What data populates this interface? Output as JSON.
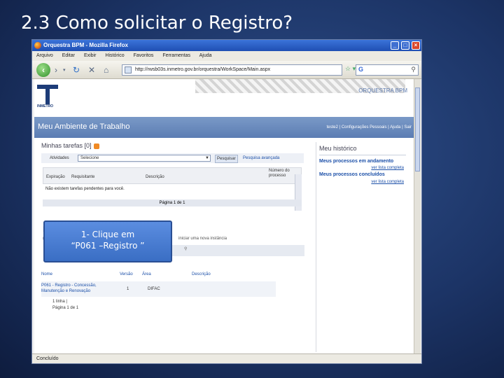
{
  "slide": {
    "title": "2.3  Como solicitar o Registro?"
  },
  "browser": {
    "window_title": "Orquestra BPM - Mozilla Firefox",
    "menu": [
      "Arquivo",
      "Editar",
      "Exibir",
      "Histórico",
      "Favoritos",
      "Ferramentas",
      "Ajuda"
    ],
    "url": "http://rwsb03s.inmetro.gov.br/orquestra/WorkSpace/Main.aspx",
    "status": "Concluído",
    "icons": {
      "back": "back-arrow-icon",
      "reload": "reload-icon",
      "stop": "stop-icon",
      "home": "home-icon",
      "search": "search-icon"
    }
  },
  "page": {
    "logo_text": "INMETRO",
    "brand": "ORQUESTRA BPM",
    "header_title": "Meu Ambiente de Trabalho",
    "header_links": "teste2 | Configurações Pessoais | Ajuda | Sair",
    "tasks": {
      "title": "Minhas tarefas [0]",
      "filter_label": "Atividades",
      "filter_value": "Selecione",
      "search_button": "Pesquisar",
      "advanced_link": "Pesquisa avançada",
      "columns": [
        "Expiração",
        "Requisitante",
        "Descrição",
        "Número do processo"
      ],
      "empty_message": "Não existem tarefas pendentes para você.",
      "paging": "Página 1 de 1"
    },
    "start": {
      "title_fragment": "P",
      "desc_fragment": "U",
      "desc_rest": "iniciar uma nova instância",
      "columns": [
        "Nome",
        "Versão",
        "Área",
        "Descrição"
      ],
      "rows": [
        {
          "name": "P061 - Registro - Concessão, Manutenção e Renovação",
          "version": "1",
          "area": "DIFAC",
          "description": ""
        }
      ],
      "count": "1 linha |",
      "paging": "Página 1 de 1"
    },
    "history": {
      "title": "Meu histórico",
      "in_progress": "Meus processos em andamento",
      "completed": "Meus processos concluídos",
      "see_all": "ver lista completa"
    }
  },
  "callout": {
    "line1": "1- Clique em",
    "line2": "“P061 –Registro ”"
  }
}
